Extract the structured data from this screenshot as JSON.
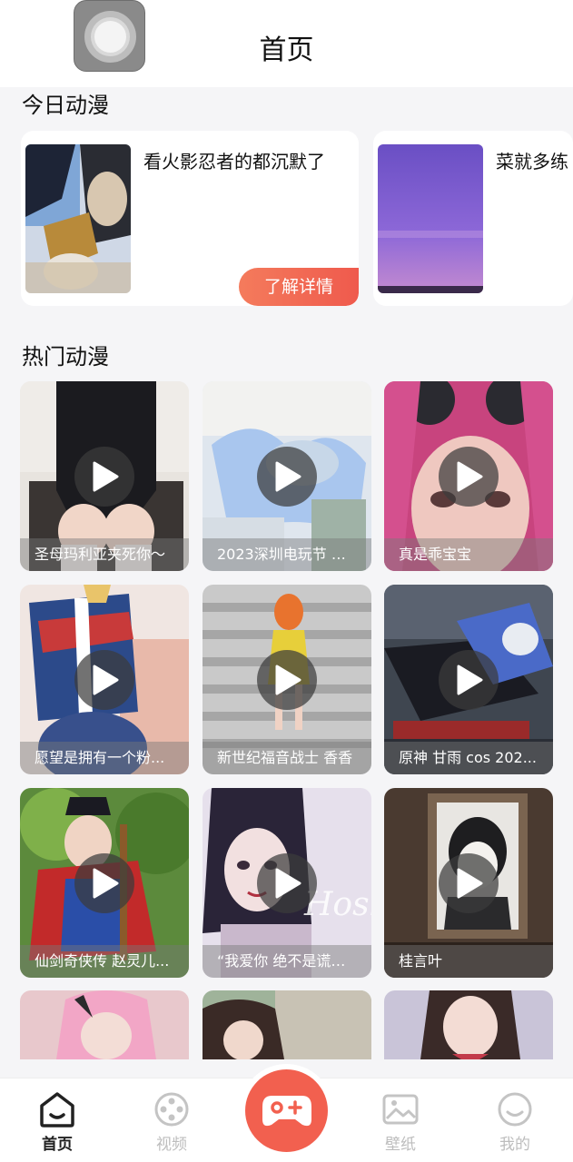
{
  "header": {
    "title": "首页"
  },
  "sections": {
    "today": "今日动漫",
    "hot": "热门动漫"
  },
  "today_cards": [
    {
      "title": "看火影忍者的都沉默了",
      "button": "了解详情"
    },
    {
      "title": "菜就多练"
    }
  ],
  "videos": [
    {
      "caption": "圣母玛利亚夹死你～"
    },
    {
      "caption": "2023深圳电玩节 魔..."
    },
    {
      "caption": "真是乖宝宝"
    },
    {
      "caption": "愿望是拥有一个粉..."
    },
    {
      "caption": "新世纪福音战士 香香"
    },
    {
      "caption": "原神 甘雨 cos 202..."
    },
    {
      "caption": "仙剑奇侠传 赵灵儿..."
    },
    {
      "caption": "“我爱你 绝不是谎言..."
    },
    {
      "caption": "桂言叶"
    }
  ],
  "tabbar": {
    "items": [
      {
        "label": "首页",
        "icon": "home-icon",
        "active": true
      },
      {
        "label": "视频",
        "icon": "gamepad-icon",
        "active": false
      },
      {
        "label": "壁纸",
        "icon": "image-icon",
        "active": false
      },
      {
        "label": "我的",
        "icon": "smile-icon",
        "active": false
      }
    ],
    "center_icon": "game-add-icon"
  },
  "colors": {
    "accent": "#f2604f",
    "inactive": "#bdbdbd",
    "active": "#222222"
  }
}
